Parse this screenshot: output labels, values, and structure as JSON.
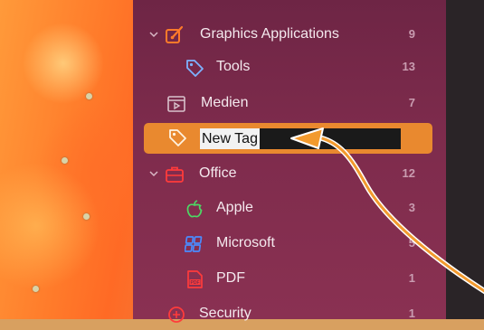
{
  "sidebar": {
    "items": [
      {
        "label": "Graphics Applications",
        "count": "9"
      },
      {
        "label": "Tools",
        "count": "13"
      },
      {
        "label": "Medien",
        "count": "7"
      },
      {
        "label": "New Tag",
        "count": ""
      },
      {
        "label": "Office",
        "count": "12"
      },
      {
        "label": "Apple",
        "count": "3"
      },
      {
        "label": "Microsoft",
        "count": "5"
      },
      {
        "label": "PDF",
        "count": "1"
      },
      {
        "label": "Security",
        "count": "1"
      }
    ]
  },
  "colors": {
    "sidebar_bg": "#7d2b4c",
    "selection": "#e9892f",
    "annotation_arrow": "#f29a2e"
  },
  "icons": [
    "chevron-down-icon",
    "brush-icon",
    "tag-icon",
    "media-icon",
    "briefcase-icon",
    "apple-icon",
    "microsoft-icon",
    "pdf-icon",
    "security-icon"
  ]
}
